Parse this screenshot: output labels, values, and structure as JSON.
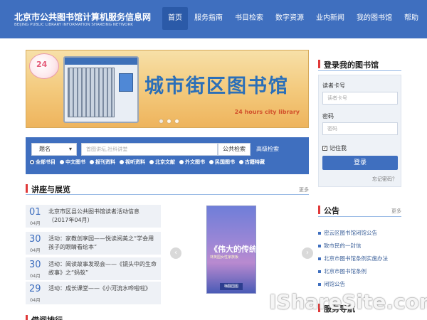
{
  "header": {
    "logo_cn": "北京市公共图书馆计算机服务信息网",
    "logo_en": "BEIJING PUBLIC LIBRARY INFORMATION SHAREING NETWORK",
    "nav": [
      "首页",
      "服务指南",
      "书目检索",
      "数字资源",
      "业内新闻",
      "我的图书馆",
      "帮助"
    ]
  },
  "banner": {
    "badge": "24",
    "title": "城市街区图书馆",
    "subtitle": "24 hours city library"
  },
  "search": {
    "select_value": "题名",
    "placeholder": "首图讲坛,社科讲堂",
    "button": "公共检索",
    "advanced": "高级检索",
    "filters": [
      "全部书目",
      "中文图书",
      "报刊资料",
      "视听资料",
      "北京文献",
      "外文图书",
      "民国图书",
      "古籍特藏"
    ]
  },
  "lectures": {
    "title": "讲座与展览",
    "more": "更多",
    "items": [
      {
        "day": "01",
        "month": "04月",
        "text": "北京市区县公共图书馆读者活动信息（2017年04月）"
      },
      {
        "day": "30",
        "month": "04月",
        "text": "活动：家教创享园——悦读阅美之“学会用孩子的眼睛看绘本”"
      },
      {
        "day": "30",
        "month": "04月",
        "text": "活动：阅读故事发现会——《镜头中的生命故事》之“蚂蚁”"
      },
      {
        "day": "29",
        "month": "04月",
        "text": "活动：成长课堂——《小河流水哗啦啦》"
      }
    ],
    "prev": "‹",
    "next": "›"
  },
  "poster": {
    "title": "《伟大的传统》中的半边天",
    "subtitle": "林英国女性家族板",
    "footer": "嗨翻国图"
  },
  "login": {
    "title": "登录我的图书馆",
    "card_label": "读者卡号",
    "card_placeholder": "读者卡号",
    "pwd_label": "密码",
    "pwd_placeholder": "密码",
    "remember": "记住我",
    "button": "登录",
    "forgot": "忘记密码？"
  },
  "notices": {
    "title": "公告",
    "more": "更多",
    "items": [
      "密云区图书馆闭馆公告",
      "致市民的一封信",
      "北京市图书馆条例实施办法",
      "北京市图书馆条例",
      "闭馆公告"
    ]
  },
  "bottom": {
    "left_title": "借阅排行",
    "right_title": "服务导航"
  },
  "watermark": "IShareSite.com",
  "colors": {
    "primary": "#3f6fbf",
    "accent": "#e03a3a"
  }
}
